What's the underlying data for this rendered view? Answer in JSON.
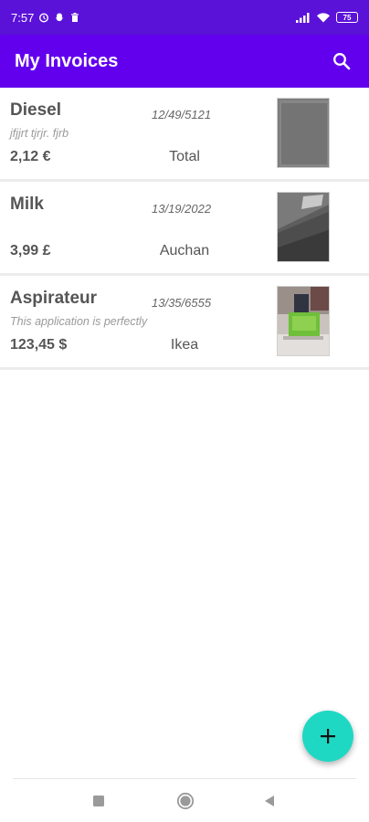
{
  "status_bar": {
    "time": "7:57",
    "battery": "75",
    "icons": [
      "alarm-icon",
      "snapchat-icon",
      "delete-icon",
      "signal-icon",
      "wifi-icon",
      "battery-icon"
    ]
  },
  "app_bar": {
    "title": "My Invoices",
    "search_icon": "search-icon",
    "color": "#6200ee"
  },
  "invoices": [
    {
      "name": "Diesel",
      "description": "jfjjrt tjrjr. fjrb",
      "date": "12/49/5121",
      "amount": "2,12 €",
      "shop": "Total"
    },
    {
      "name": "Milk",
      "description": "",
      "date": "13/19/2022",
      "amount": "3,99 £",
      "shop": "Auchan"
    },
    {
      "name": "Aspirateur",
      "description": "This application is perfectly",
      "date": "13/35/6555",
      "amount": "123,45 $",
      "shop": "Ikea"
    }
  ],
  "fab": {
    "icon": "plus-icon",
    "color": "#1fd8c4"
  },
  "nav_bar": {
    "icons": [
      "recent-apps-icon",
      "home-icon",
      "back-icon"
    ]
  }
}
